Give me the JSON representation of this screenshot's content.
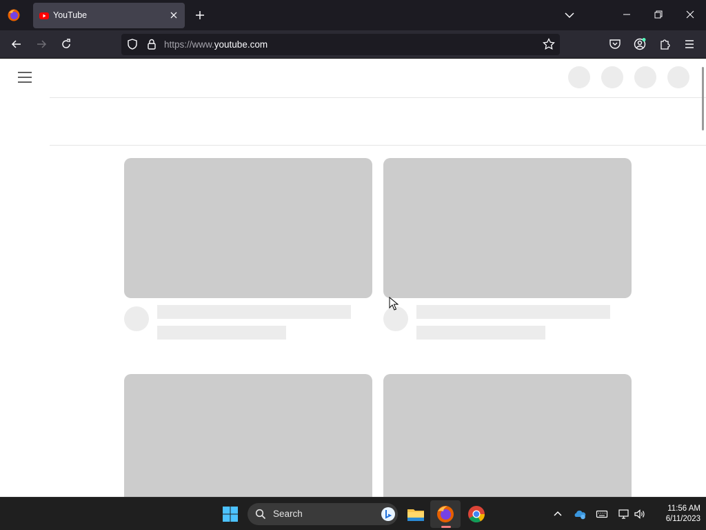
{
  "browser": {
    "tab": {
      "title": "YouTube"
    },
    "url": {
      "scheme_prefix": "https://www.",
      "host": "youtube.com"
    }
  },
  "taskbar": {
    "search_label": "Search",
    "clock": {
      "time": "11:56 AM",
      "date": "6/11/2023"
    }
  },
  "colors": {
    "tabbar_bg": "#1c1b22",
    "navbar_bg": "#2b2a33",
    "skeleton_thumb": "#cccccc",
    "skeleton_line": "#ececec",
    "taskbar_bg": "#1f1f1f"
  },
  "icons": {
    "browser": [
      "firefox-icon",
      "youtube-favicon",
      "close-tab-icon",
      "new-tab-icon",
      "list-all-tabs-icon",
      "minimize-icon",
      "restore-icon",
      "close-window-icon"
    ],
    "navbar": [
      "back-icon",
      "forward-icon",
      "reload-icon",
      "shield-icon",
      "lock-icon",
      "bookmark-star-icon",
      "pocket-icon",
      "account-icon",
      "extensions-icon",
      "menu-icon"
    ],
    "taskbar": [
      "windows-start-icon",
      "search-icon",
      "bing-icon",
      "file-explorer-icon",
      "firefox-icon",
      "chrome-icon",
      "chevron-up-icon",
      "onedrive-icon",
      "keyboard-icon",
      "network-icon",
      "volume-icon"
    ]
  }
}
